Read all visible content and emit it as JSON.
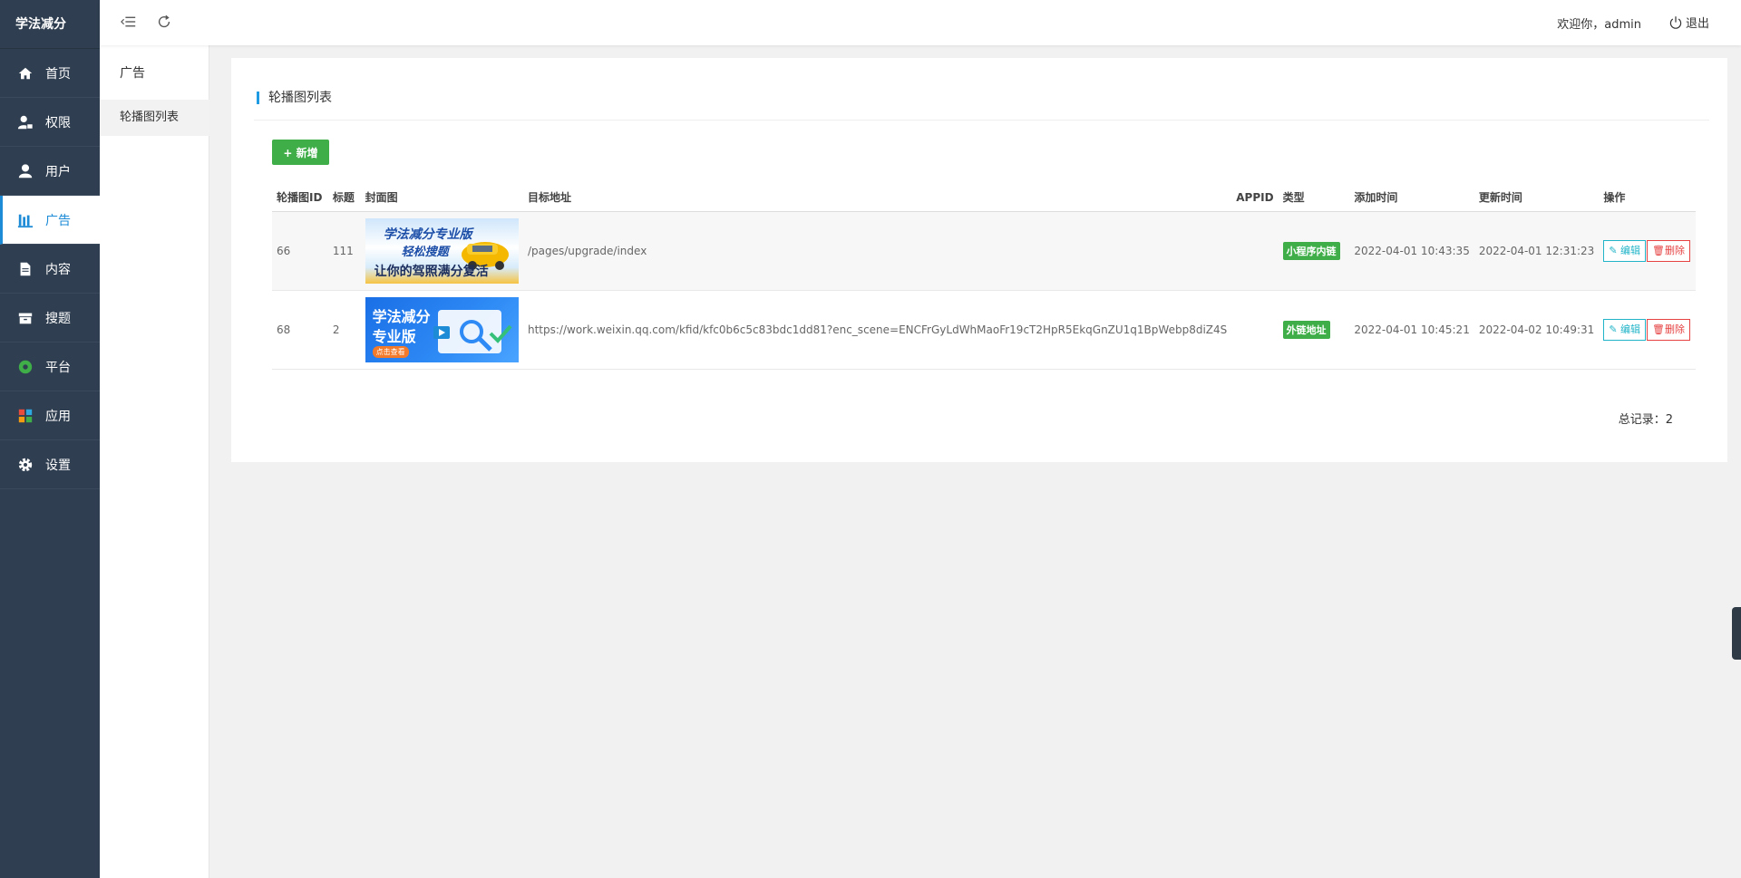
{
  "brand": "学法减分",
  "sidebar": {
    "items": [
      {
        "label": "首页",
        "icon": "home-icon"
      },
      {
        "label": "权限",
        "icon": "user-lock-icon"
      },
      {
        "label": "用户",
        "icon": "user-icon"
      },
      {
        "label": "广告",
        "icon": "ad-icon",
        "active": true
      },
      {
        "label": "内容",
        "icon": "document-icon"
      },
      {
        "label": "搜题",
        "icon": "archive-icon"
      },
      {
        "label": "平台",
        "icon": "platform-icon"
      },
      {
        "label": "应用",
        "icon": "apps-icon"
      },
      {
        "label": "设置",
        "icon": "gear-icon"
      }
    ]
  },
  "subnav": {
    "title": "广告",
    "items": [
      {
        "label": "轮播图列表"
      }
    ]
  },
  "header": {
    "welcome": "欢迎你，admin",
    "logout": "退出"
  },
  "card": {
    "title": "轮播图列表",
    "add_label": "+ 新增"
  },
  "table": {
    "columns": [
      "轮播图ID",
      "标题",
      "封面图",
      "目标地址",
      "APPID",
      "类型",
      "添加时间",
      "更新时间",
      "操作"
    ],
    "rows": [
      {
        "id": "66",
        "title": "111",
        "cover_text": [
          "学法减分专业版",
          "轻松搜题",
          "让你的驾照满分复活"
        ],
        "target": "/pages/upgrade/index",
        "appid": "",
        "type": "小程序内链",
        "added": "2022-04-01 10:43:35",
        "updated": "2022-04-01 12:31:23"
      },
      {
        "id": "68",
        "title": "2",
        "cover_text": [
          "学法减分",
          "专业版",
          "点击查看"
        ],
        "target": "https://work.weixin.qq.com/kfid/kfc0b6c5c83bdc1dd81?enc_scene=ENCFrGyLdWhMaoFr19cT2HpR5EkqGnZU1q1BpWebp8diZ4S",
        "appid": "",
        "type": "外链地址",
        "added": "2022-04-01 10:45:21",
        "updated": "2022-04-02 10:49:31"
      }
    ],
    "edit_label": "编辑",
    "delete_label": "删除"
  },
  "total": "总记录：2",
  "colors": {
    "sidebar_bg": "#2f3e50",
    "accent": "#1e8bd6",
    "add_green": "#3fae48",
    "edit_cyan": "#21b4c8",
    "delete_red": "#e64242"
  }
}
